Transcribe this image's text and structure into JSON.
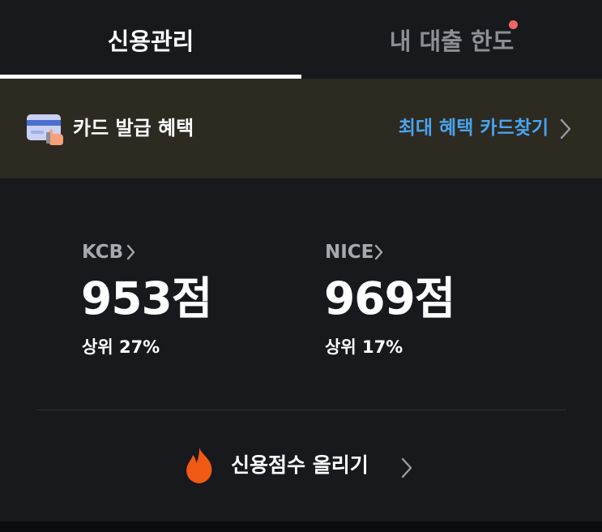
{
  "tabs": [
    {
      "label": "신용관리",
      "active": true
    },
    {
      "label": "내 대출 한도",
      "active": false,
      "has_notification_dot": true
    }
  ],
  "banner": {
    "icon": "credit-card-icon",
    "title": "카드 발급 혜택",
    "link_text": "최대 혜택 카드찾기"
  },
  "scores": [
    {
      "agency": "KCB",
      "value": "953점",
      "rank": "상위 27%"
    },
    {
      "agency": "NICE",
      "value": "969점",
      "rank": "상위 17%"
    }
  ],
  "boost": {
    "icon": "fire-icon",
    "label": "신용점수 올리기"
  },
  "colors": {
    "background": "#17191c",
    "banner_background": "#2c2a21",
    "link_blue": "#4aa3ee",
    "inactive_tab": "#8c8f94",
    "notification_dot": "#f0646a",
    "fire": "#f05a14"
  }
}
